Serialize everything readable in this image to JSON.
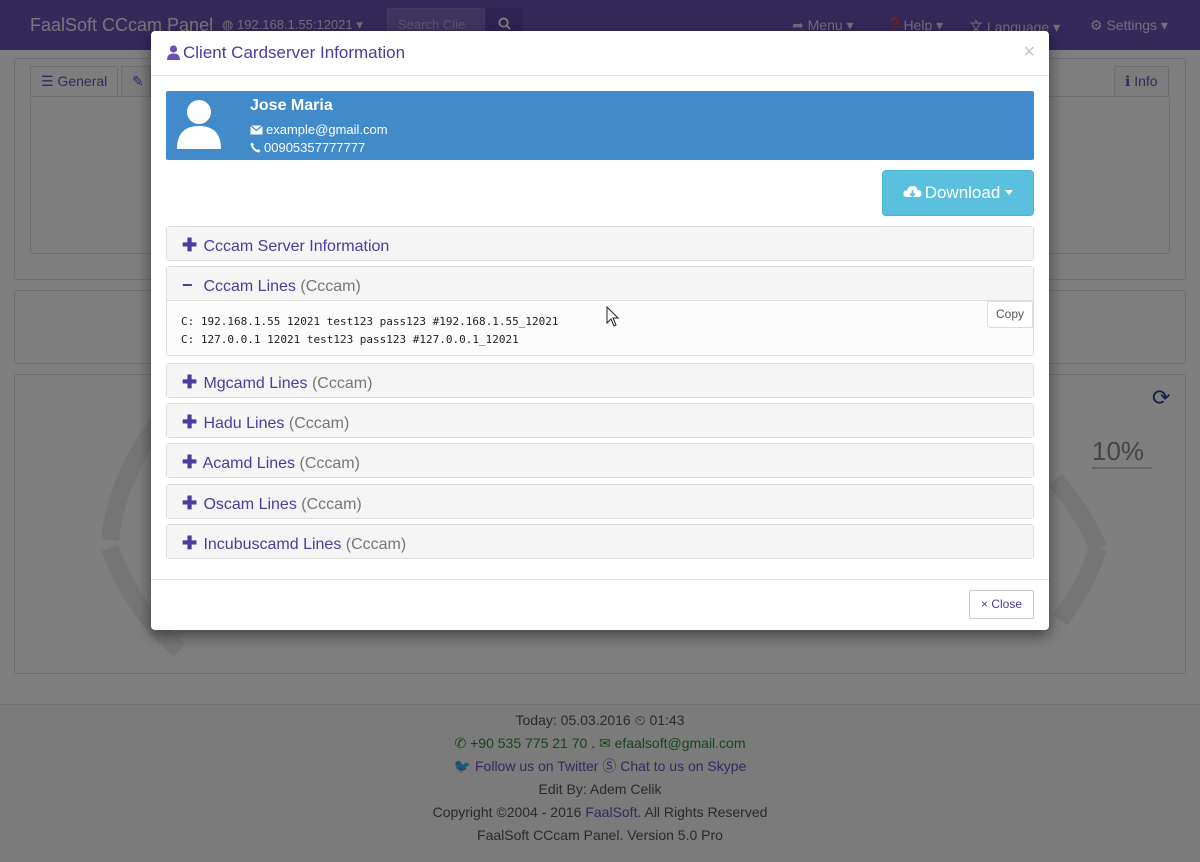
{
  "app": {
    "brand": "FaalSoft CCcam Panel",
    "server_address": "192.168.1.55:12021",
    "search_placeholder": "Search Clie",
    "nav": {
      "menu": "Menu",
      "help": "Help",
      "language": "Language",
      "settings": "Settings"
    }
  },
  "background": {
    "tabs": {
      "general": "General",
      "info": "Info"
    },
    "percentage": "10%"
  },
  "modal": {
    "title": "Client Cardserver Information",
    "close_symbol": "×",
    "profile": {
      "name": "Jose Maria",
      "email": "example@gmail.com",
      "phone": "00905357777777"
    },
    "download_label": "Download",
    "accordion": [
      {
        "title": "Cccam Server Information",
        "suffix": "",
        "expanded": false
      },
      {
        "title": "Cccam Lines",
        "suffix": "(Cccam)",
        "expanded": true
      },
      {
        "title": "Mgcamd Lines",
        "suffix": "(Cccam)",
        "expanded": false
      },
      {
        "title": "Hadu Lines",
        "suffix": "(Cccam)",
        "expanded": false
      },
      {
        "title": "Acamd Lines",
        "suffix": "(Cccam)",
        "expanded": false
      },
      {
        "title": "Oscam Lines",
        "suffix": "(Cccam)",
        "expanded": false
      },
      {
        "title": "Incubuscamd Lines",
        "suffix": "(Cccam)",
        "expanded": false
      }
    ],
    "cccam_lines": [
      "C: 192.168.1.55 12021 test123 pass123 #192.168.1.55_12021",
      "C: 127.0.0.1 12021 test123 pass123 #127.0.0.1_12021"
    ],
    "copy_label": "Copy",
    "close_label": "× Close"
  },
  "footer": {
    "today": "Today: 05.03.2016",
    "time": "01:43",
    "phone": "+90 535 775 21 70",
    "separator": ".",
    "email": "efaalsoft@gmail.com",
    "twitter": "Follow us on Twitter",
    "skype": "Chat to us on Skype",
    "edit_by": "Edit By: Adem Celik",
    "copyright_prefix": "Copyright ©2004 - 2016",
    "copyright_link": "FaalSoft",
    "copyright_suffix": ". All Rights Reserved",
    "version": "FaalSoft CCcam Panel. Version 5.0 Pro"
  },
  "colors": {
    "navbar": "#6a52b5",
    "profile_bg": "#428bca",
    "download_bg": "#5bc0de",
    "accent_text": "#4b3c9e"
  }
}
